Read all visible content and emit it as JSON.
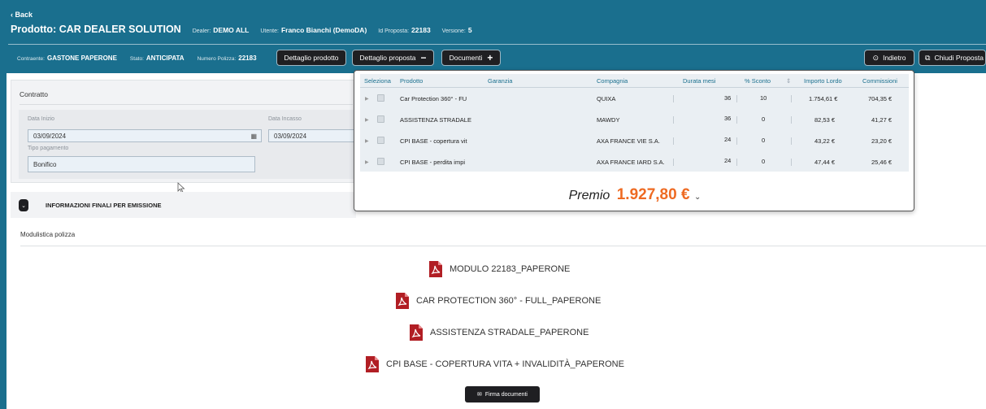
{
  "header": {
    "back": "‹ Back",
    "product": "Prodotto: CAR DEALER SOLUTION",
    "dealer_label": "Dealer:",
    "dealer_value": "DEMO ALL",
    "utente_label": "Utente:",
    "utente_value": "Franco Bianchi (DemoDA)",
    "proposta_label": "Id Proposta:",
    "proposta_value": "22183",
    "versione_label": "Versione:",
    "versione_value": "5",
    "contraente_label": "Contraente:",
    "contraente_value": "GASTONE PAPERONE",
    "stato_label": "Stato:",
    "stato_value": "ANTICIPATA",
    "polizza_label": "Numero Polizza:",
    "polizza_value": "22183",
    "buttons": {
      "dettaglio_prodotto": "Dettaglio prodotto",
      "dettaglio_proposta": "Dettaglio proposta",
      "documenti": "Documenti",
      "indietro": "Indietro",
      "chiudi": "Chiudi Proposta"
    }
  },
  "contratto": {
    "title": "Contratto",
    "data_inizio_label": "Data Inizio",
    "data_inizio": "03/09/2024",
    "data_incasso_label": "Data Incasso",
    "data_incasso": "03/09/2024",
    "tipo_pagamento_label": "Tipo pagamento",
    "tipo_pagamento": "Bonifico"
  },
  "info_finali": "INFORMAZIONI FINALI PER EMISSIONE",
  "modulistica": {
    "title": "Modulistica polizza",
    "docs": [
      "MODULO 22183_PAPERONE",
      "CAR PROTECTION 360° - FULL_PAPERONE",
      "ASSISTENZA STRADALE_PAPERONE",
      "CPI BASE - COPERTURA VITA + INVALIDITÀ_PAPERONE"
    ],
    "firma": "Firma documenti"
  },
  "proposta_table": {
    "headers": [
      "Seleziona",
      "Prodotto",
      "Garanzia",
      "Compagnia",
      "Durata mesi",
      "% Sconto",
      "Importo Lordo",
      "Commissioni"
    ],
    "rows": [
      {
        "prodotto": "Car Protection 360° - FU",
        "compagnia": "QUIXA",
        "durata": "36",
        "sconto": "10",
        "importo": "1.754,61 €",
        "commissioni": "704,35 €"
      },
      {
        "prodotto": "ASSISTENZA STRADALE",
        "compagnia": "MAWDY",
        "durata": "36",
        "sconto": "0",
        "importo": "82,53 €",
        "commissioni": "41,27 €"
      },
      {
        "prodotto": "CPI BASE - copertura vit",
        "compagnia": "AXA FRANCE VIE S.A.",
        "durata": "24",
        "sconto": "0",
        "importo": "43,22 €",
        "commissioni": "23,20 €"
      },
      {
        "prodotto": "CPI BASE - perdita impi",
        "compagnia": "AXA FRANCE IARD S.A.",
        "durata": "24",
        "sconto": "0",
        "importo": "47,44 €",
        "commissioni": "25,46 €"
      }
    ],
    "premio_label": "Premio",
    "premio_value": "1.927,80 €"
  },
  "colors": {
    "header": "#1a6f8e",
    "premio": "#ee6a22",
    "dark_button": "#1f1f22",
    "pdf": "#b11e24"
  },
  "icons": [
    "pdf-icon",
    "calendar-icon",
    "mail-icon",
    "chevron-down-icon",
    "external-link-icon",
    "circle-arrow-icon"
  ]
}
